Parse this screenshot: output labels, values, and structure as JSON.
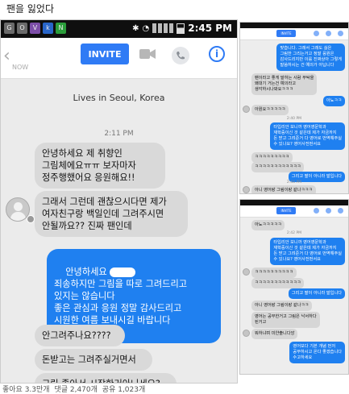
{
  "post": {
    "title": "팬을 잃었다",
    "likes": "좋아요 3.3만개",
    "comments": "댓글 2,470개",
    "shares": "공유 1,023개"
  },
  "main": {
    "statusbar": {
      "time": "2:45 PM",
      "left_icons": [
        "G",
        "O",
        "V",
        "k",
        "N"
      ]
    },
    "header": {
      "back": "‹",
      "now": "NOW",
      "invite": "INVITE",
      "info": "i"
    },
    "location": "Lives in Seoul, Korea",
    "timestamp": "2:11 PM",
    "messages": [
      {
        "from": "them",
        "text": "안녕하세요 제 취향인\n그림체에요ㅠㅠ 보자마자\n정주행했어요 응원해요!!"
      },
      {
        "from": "them",
        "text": "그래서 그런데 괜찮으시다면 제가\n여자친구랑 백일인데 그려주시면\n안될까요?? 진짜 팬인데"
      },
      {
        "from": "me",
        "text_1": "안녕하세요",
        "text_2": "죄송하지만 그림을 따로 그려드리고\n있지는 않습니다\n좋은 관심과 응원 정말 감사드리고\n시원한 여름 보내시길 바랍니다"
      },
      {
        "from": "them",
        "text": "안그려주나요????"
      },
      {
        "from": "them",
        "text": "돈받고는 그려주실거면서"
      },
      {
        "from": "them",
        "text": "그림 좋아서 시작한거아니세요?"
      }
    ]
  },
  "panel_top": {
    "invite": "INVITE",
    "messages": [
      {
        "from": "them",
        "text": "맞습니다. 그래서 그래도 싫은\n그림한 그리는거고 정말 응원은\n감사드리지만 이를 진짜상아 그렇게\n말씀하시는 건 예의가 아닙니다"
      },
      {
        "from": "them",
        "text": "팬이라고 좋게 말하는 사람 부탁을\n왜대기 거는건 예의라고\n생각하시나봐요ㅋㅋㅋ"
      },
      {
        "from": "me",
        "text": "아뇨ㅋㅋ"
      },
      {
        "from": "them",
        "text": "아원요ㅋㅋㅋㅋㅋ"
      },
      {
        "time": "2:40 PM"
      },
      {
        "from": "me",
        "text": "타입리안 보니까 영어영문학과\n재학중이신 것 같은데 제가 자금까지\n돈 받고 그려준거 다 영어로 번역해주실\n수 있나요? 영어사전펀서요"
      },
      {
        "from": "them",
        "text": "ㅋㅋㅋㅋㅋㅋㅋㅋㅋ"
      },
      {
        "from": "them",
        "text": "ㅋㅋㅋㅋㅋㅋㅋㅋㅋㅋㅋㅋ"
      },
      {
        "from": "me",
        "text": "그리고 팔이 아니라 발입니다"
      },
      {
        "time": "2:44 PM"
      },
      {
        "from": "them",
        "text": "아니 영어랑 그림이랑 같나ㅋㅋㅋ"
      }
    ]
  },
  "panel_bottom": {
    "invite": "INVITE",
    "messages": [
      {
        "from": "them",
        "text": "아뇨ㅋㅋㅋㅋㅋ"
      },
      {
        "time": "2:42 PM"
      },
      {
        "from": "me",
        "text": "타입리안 보니까 영어영문학과\n재학중이신 것 같은데 제가 자금까지\n돈 받고 그려준거 다 영어로 번역해주실\n수 있나요? 영어사전펀서요"
      },
      {
        "from": "them",
        "text": "ㅋㅋㅋㅋㅋㅋㅋㅋㅋㅋ"
      },
      {
        "from": "them",
        "text": "ㅋㅋㅋㅋㅋㅋㅋㅋㅋㅋㅋㅋ"
      },
      {
        "from": "me",
        "text": "그리고 팔이 아니라 발입니다"
      },
      {
        "from": "them",
        "text": "아니 영어랑 그림이랑 같나ㅋㅋ"
      },
      {
        "from": "them",
        "text": "영어는 공부한거고 그림은 낙서하다\n된거고"
      },
      {
        "from": "them",
        "text": "뭐하냐며 미얀출니다앙"
      },
      {
        "from": "me",
        "text": "영어보다 기본 개념 먼저\n공부하시고 온다 좋겠습니다\n수고하세요"
      }
    ]
  }
}
